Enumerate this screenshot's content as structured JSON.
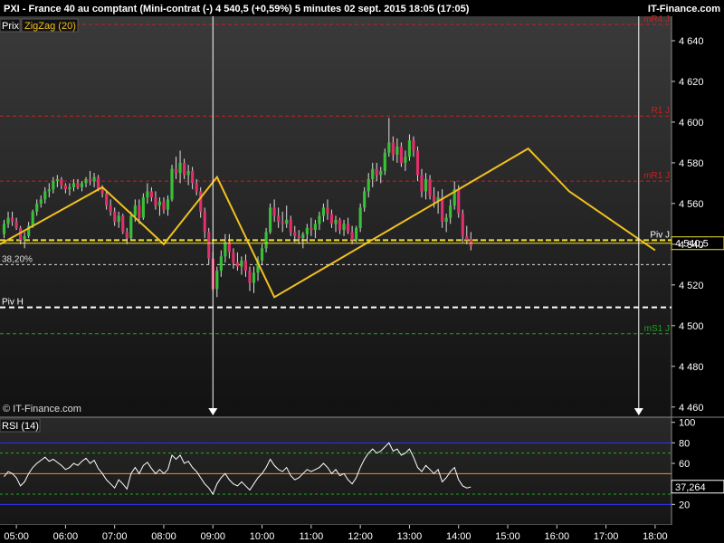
{
  "header": {
    "title": "PXI - France 40 au comptant (Mini-contrat  (-)   4 540,5 (+0,59%)     5 minutes  02 sept. 2015 18:05 (17:05)",
    "brand": "IT-Finance.com"
  },
  "legend": {
    "price": "Prix",
    "indicator": "ZigZag (20)"
  },
  "watermark": "© IT-Finance.com",
  "colors": {
    "bull": "#38c038",
    "bear": "#e0306a",
    "zigzag": "#f0c020",
    "resistance": "#c82020",
    "support": "#20a020",
    "pivot": "#ffffff",
    "last_price": "#f0e030",
    "rsi_line": "#ffffff",
    "rsi_band": "#3030ff",
    "rsi_mid": "#ff9020"
  },
  "chart_data": [
    {
      "type": "candlestick",
      "title": "PXI - France 40 au comptant (Mini-contrat (-) 5 minutes",
      "ylim": [
        4455,
        4652
      ],
      "y_ticks": [
        4460,
        4480,
        4500,
        4520,
        4540,
        4560,
        4580,
        4600,
        4620,
        4640
      ],
      "y_tick_labels": [
        "4 460",
        "4 480",
        "4 500",
        "4 520",
        "4 540",
        "4 560",
        "4 580",
        "4 600",
        "4 620",
        "4 640"
      ],
      "x_ticks": [
        "05:00",
        "06:00",
        "07:00",
        "08:00",
        "09:00",
        "10:00",
        "11:00",
        "12:00",
        "13:00",
        "14:00",
        "15:00",
        "16:00",
        "17:00",
        "18:00"
      ],
      "x_range": [
        "04:40",
        "18:20"
      ],
      "last_price": 4540.5,
      "last_price_label": "4 540,5",
      "levels": [
        {
          "name": "R1 J",
          "value": 4603
        },
        {
          "name": "mR1 J",
          "value": 4571
        },
        {
          "name": "mS1 J",
          "value": 4496
        },
        {
          "name": "Piv H",
          "value": 4509
        },
        {
          "name": "38,20%",
          "value": 4530
        },
        {
          "name": "Piv J",
          "value": 4542
        },
        {
          "name": "mR4 J",
          "value": 4648
        }
      ],
      "vertical_markers": [
        "09:00",
        "17:40"
      ],
      "zigzag": [
        {
          "t": "04:40",
          "v": 4540
        },
        {
          "t": "06:45",
          "v": 4568
        },
        {
          "t": "08:00",
          "v": 4540
        },
        {
          "t": "09:05",
          "v": 4573
        },
        {
          "t": "10:15",
          "v": 4514
        },
        {
          "t": "15:25",
          "v": 4587
        },
        {
          "t": "16:15",
          "v": 4566
        },
        {
          "t": "18:00",
          "v": 4537
        }
      ],
      "candles_5min_from_04:40": [
        [
          4545,
          4552,
          4543,
          4550
        ],
        [
          4550,
          4556,
          4548,
          4553
        ],
        [
          4553,
          4556,
          4549,
          4551
        ],
        [
          4551,
          4553,
          4547,
          4548
        ],
        [
          4548,
          4549,
          4540,
          4542
        ],
        [
          4542,
          4546,
          4538,
          4544
        ],
        [
          4544,
          4551,
          4543,
          4549
        ],
        [
          4549,
          4557,
          4548,
          4556
        ],
        [
          4556,
          4562,
          4554,
          4560
        ],
        [
          4560,
          4564,
          4558,
          4562
        ],
        [
          4562,
          4568,
          4560,
          4566
        ],
        [
          4566,
          4570,
          4563,
          4567
        ],
        [
          4567,
          4573,
          4565,
          4571
        ],
        [
          4571,
          4574,
          4568,
          4572
        ],
        [
          4572,
          4573,
          4567,
          4569
        ],
        [
          4569,
          4570,
          4565,
          4567
        ],
        [
          4567,
          4570,
          4564,
          4568
        ],
        [
          4568,
          4572,
          4566,
          4570
        ],
        [
          4570,
          4572,
          4567,
          4568
        ],
        [
          4568,
          4571,
          4566,
          4570
        ],
        [
          4570,
          4573,
          4568,
          4572
        ],
        [
          4572,
          4576,
          4569,
          4571
        ],
        [
          4571,
          4575,
          4568,
          4573
        ],
        [
          4573,
          4574,
          4566,
          4567
        ],
        [
          4567,
          4569,
          4563,
          4565
        ],
        [
          4565,
          4566,
          4557,
          4559
        ],
        [
          4559,
          4562,
          4554,
          4556
        ],
        [
          4556,
          4558,
          4549,
          4551
        ],
        [
          4551,
          4556,
          4548,
          4554
        ],
        [
          4554,
          4555,
          4545,
          4546
        ],
        [
          4546,
          4548,
          4540,
          4543
        ],
        [
          4543,
          4556,
          4542,
          4554
        ],
        [
          4554,
          4562,
          4551,
          4559
        ],
        [
          4559,
          4562,
          4550,
          4553
        ],
        [
          4553,
          4565,
          4552,
          4563
        ],
        [
          4563,
          4570,
          4560,
          4566
        ],
        [
          4566,
          4568,
          4561,
          4563
        ],
        [
          4563,
          4566,
          4557,
          4559
        ],
        [
          4559,
          4563,
          4554,
          4561
        ],
        [
          4561,
          4563,
          4555,
          4557
        ],
        [
          4557,
          4564,
          4554,
          4562
        ],
        [
          4562,
          4579,
          4561,
          4577
        ],
        [
          4577,
          4583,
          4572,
          4575
        ],
        [
          4575,
          4586,
          4570,
          4580
        ],
        [
          4580,
          4582,
          4572,
          4574
        ],
        [
          4574,
          4579,
          4569,
          4576
        ],
        [
          4576,
          4578,
          4567,
          4570
        ],
        [
          4570,
          4572,
          4564,
          4566
        ],
        [
          4566,
          4568,
          4553,
          4556
        ],
        [
          4556,
          4558,
          4543,
          4546
        ],
        [
          4546,
          4548,
          4530,
          4533
        ],
        [
          4533,
          4536,
          4517,
          4518
        ],
        [
          4518,
          4529,
          4514,
          4527
        ],
        [
          4527,
          4537,
          4524,
          4534
        ],
        [
          4534,
          4545,
          4531,
          4541
        ],
        [
          4541,
          4545,
          4533,
          4536
        ],
        [
          4536,
          4538,
          4528,
          4531
        ],
        [
          4531,
          4536,
          4527,
          4529
        ],
        [
          4529,
          4534,
          4525,
          4532
        ],
        [
          4532,
          4535,
          4524,
          4527
        ],
        [
          4527,
          4529,
          4517,
          4521
        ],
        [
          4521,
          4529,
          4516,
          4526
        ],
        [
          4526,
          4534,
          4522,
          4532
        ],
        [
          4532,
          4540,
          4530,
          4538
        ],
        [
          4538,
          4548,
          4536,
          4546
        ],
        [
          4546,
          4560,
          4545,
          4558
        ],
        [
          4558,
          4562,
          4551,
          4554
        ],
        [
          4554,
          4558,
          4548,
          4551
        ],
        [
          4551,
          4556,
          4546,
          4550
        ],
        [
          4550,
          4559,
          4548,
          4552
        ],
        [
          4552,
          4554,
          4544,
          4546
        ],
        [
          4546,
          4549,
          4541,
          4544
        ],
        [
          4544,
          4547,
          4540,
          4543
        ],
        [
          4543,
          4546,
          4538,
          4545
        ],
        [
          4545,
          4550,
          4541,
          4548
        ],
        [
          4548,
          4553,
          4544,
          4547
        ],
        [
          4547,
          4552,
          4543,
          4550
        ],
        [
          4550,
          4556,
          4547,
          4554
        ],
        [
          4554,
          4560,
          4551,
          4558
        ],
        [
          4558,
          4562,
          4552,
          4555
        ],
        [
          4555,
          4557,
          4548,
          4550
        ],
        [
          4550,
          4554,
          4546,
          4552
        ],
        [
          4552,
          4553,
          4545,
          4547
        ],
        [
          4547,
          4552,
          4544,
          4550
        ],
        [
          4550,
          4553,
          4545,
          4546
        ],
        [
          4546,
          4549,
          4540,
          4542
        ],
        [
          4542,
          4549,
          4541,
          4548
        ],
        [
          4548,
          4560,
          4546,
          4558
        ],
        [
          4558,
          4568,
          4556,
          4566
        ],
        [
          4566,
          4575,
          4563,
          4572
        ],
        [
          4572,
          4580,
          4568,
          4577
        ],
        [
          4577,
          4580,
          4571,
          4574
        ],
        [
          4574,
          4578,
          4570,
          4576
        ],
        [
          4576,
          4587,
          4574,
          4585
        ],
        [
          4585,
          4602,
          4583,
          4590
        ],
        [
          4590,
          4593,
          4581,
          4584
        ],
        [
          4584,
          4592,
          4580,
          4588
        ],
        [
          4588,
          4590,
          4578,
          4580
        ],
        [
          4580,
          4586,
          4576,
          4583
        ],
        [
          4583,
          4594,
          4581,
          4591
        ],
        [
          4591,
          4593,
          4583,
          4586
        ],
        [
          4586,
          4588,
          4571,
          4574
        ],
        [
          4574,
          4577,
          4563,
          4566
        ],
        [
          4566,
          4575,
          4562,
          4572
        ],
        [
          4572,
          4574,
          4562,
          4564
        ],
        [
          4564,
          4568,
          4558,
          4561
        ],
        [
          4561,
          4566,
          4555,
          4563
        ],
        [
          4563,
          4567,
          4548,
          4551
        ],
        [
          4551,
          4555,
          4546,
          4553
        ],
        [
          4553,
          4562,
          4550,
          4559
        ],
        [
          4559,
          4571,
          4557,
          4567
        ],
        [
          4567,
          4569,
          4553,
          4555
        ],
        [
          4555,
          4557,
          4541,
          4544
        ],
        [
          4544,
          4549,
          4540,
          4542
        ],
        [
          4542,
          4546,
          4537,
          4539
        ]
      ]
    },
    {
      "type": "line",
      "name": "RSI (14)",
      "ylim": [
        0,
        105
      ],
      "y_ticks": [
        20,
        40,
        60,
        80,
        100
      ],
      "bands": [
        20,
        30,
        50,
        70,
        80
      ],
      "last_value": 37.264,
      "last_value_label": "37,264",
      "values": [
        47,
        52,
        50,
        46,
        38,
        42,
        50,
        56,
        60,
        63,
        66,
        62,
        64,
        61,
        58,
        54,
        56,
        60,
        58,
        62,
        65,
        60,
        63,
        55,
        50,
        44,
        40,
        36,
        44,
        40,
        35,
        50,
        56,
        50,
        58,
        61,
        55,
        50,
        54,
        50,
        54,
        68,
        64,
        68,
        60,
        62,
        56,
        52,
        46,
        40,
        36,
        30,
        40,
        46,
        50,
        44,
        40,
        38,
        42,
        38,
        34,
        40,
        46,
        50,
        56,
        64,
        58,
        54,
        52,
        56,
        48,
        44,
        46,
        50,
        54,
        52,
        54,
        56,
        60,
        56,
        50,
        54,
        48,
        50,
        44,
        40,
        46,
        56,
        64,
        70,
        74,
        70,
        72,
        76,
        80,
        72,
        74,
        68,
        70,
        74,
        66,
        56,
        52,
        58,
        54,
        50,
        54,
        42,
        46,
        52,
        56,
        44,
        38,
        36,
        37
      ]
    }
  ],
  "rsi_panel": {
    "title": "RSI (14)"
  }
}
